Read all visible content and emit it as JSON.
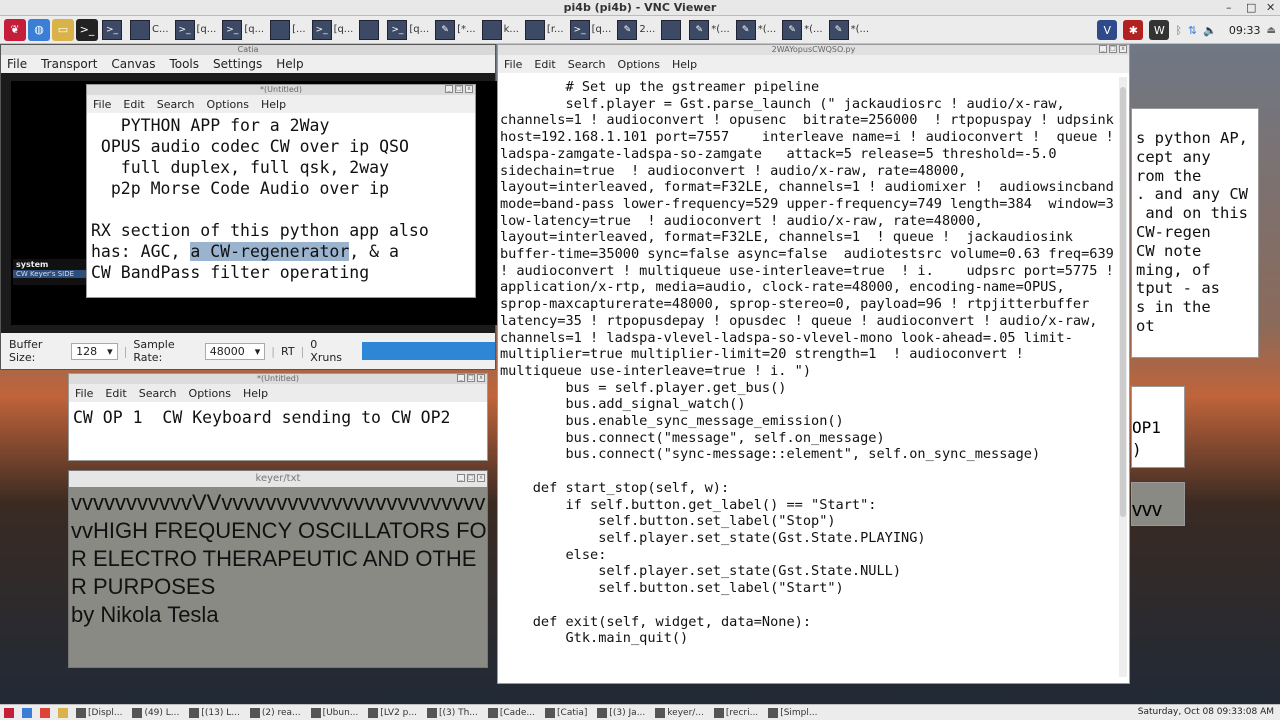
{
  "vnc": {
    "title": "pi4b (pi4b) - VNC Viewer",
    "controls": [
      "–",
      "□",
      "✕"
    ]
  },
  "top_panel": {
    "tasks": [
      {
        "label": "",
        "icon": "terminal-icon"
      },
      {
        "label": "C...",
        "icon": "cadence-icon"
      },
      {
        "label": "[q...",
        "icon": "terminal-icon"
      },
      {
        "label": "[q...",
        "icon": "terminal-icon"
      },
      {
        "label": "[...",
        "icon": "lv2-icon"
      },
      {
        "label": "[q...",
        "icon": "terminal-icon"
      },
      {
        "label": "",
        "icon": "raspberry-icon"
      },
      {
        "label": "[q...",
        "icon": "terminal-icon"
      },
      {
        "label": "[*...",
        "icon": "pencil-icon"
      },
      {
        "label": "k...",
        "icon": "keyer-icon"
      },
      {
        "label": "[r...",
        "icon": "file-icon"
      },
      {
        "label": "[q...",
        "icon": "terminal-icon"
      },
      {
        "label": "2...",
        "icon": "pencil-icon"
      },
      {
        "label": "",
        "icon": "window-icon"
      },
      {
        "label": "*(...",
        "icon": "pencil-icon"
      },
      {
        "label": "*(...",
        "icon": "pencil-icon"
      },
      {
        "label": "*(...",
        "icon": "pencil-icon"
      },
      {
        "label": "*(...",
        "icon": "pencil-icon"
      }
    ],
    "clock": "09:33"
  },
  "catia": {
    "title": "Catia",
    "menu": [
      "File",
      "Transport",
      "Canvas",
      "Tools",
      "Settings",
      "Help"
    ],
    "system_label": "system",
    "port_label": "CW Keyer's SIDE",
    "buffer_size_label": "Buffer Size:",
    "buffer_size_value": "128",
    "sample_rate_label": "Sample Rate:",
    "sample_rate_value": "48000",
    "rt_label": "RT",
    "xruns_label": "0 Xruns"
  },
  "editor1": {
    "title": "*(Untitled)",
    "menu": [
      "File",
      "Edit",
      "Search",
      "Options",
      "Help"
    ],
    "lines_a": "   PYTHON APP for a 2Way\n OPUS audio codec CW over ip QSO\n   full duplex, full qsk, 2way\n  p2p Morse Code Audio over ip\n\nRX section of this python app also\nhas: AGC, ",
    "highlight": "a CW-regenerator",
    "lines_b": ", & a\nCW BandPass filter operating"
  },
  "editor2": {
    "title": "*(Untitled)",
    "menu": [
      "File",
      "Edit",
      "Search",
      "Options",
      "Help"
    ],
    "text": "CW OP 1  CW Keyboard sending to CW OP2"
  },
  "keyer": {
    "title": "keyer/txt",
    "text": "vvvvvvvvvvvVVvvvvvvvvvvvvvvvvvvvvvvvvvvHIGH FREQUENCY OSCILLATORS FOR ELECTRO THERAPEUTIC AND OTHER PURPOSES\nby Nikola Tesla"
  },
  "code_editor": {
    "title": "2WAYopusCWQSO.py",
    "menu": [
      "File",
      "Edit",
      "Search",
      "Options",
      "Help"
    ],
    "code": "        # Set up the gstreamer pipeline\n        self.player = Gst.parse_launch (\" jackaudiosrc ! audio/x-raw, channels=1 ! audioconvert ! opusenc  bitrate=256000  ! rtpopuspay ! udpsink host=192.168.1.101 port=7557    interleave name=i ! audioconvert !  queue !  ladspa-zamgate-ladspa-so-zamgate   attack=5 release=5 threshold=-5.0  sidechain=true  ! audioconvert ! audio/x-raw, rate=48000, layout=interleaved, format=F32LE, channels=1 ! audiomixer !  audiowsincband mode=band-pass lower-frequency=529 upper-frequency=749 length=384  window=3 low-latency=true  ! audioconvert ! audio/x-raw, rate=48000, layout=interleaved, format=F32LE, channels=1  ! queue !  jackaudiosink buffer-time=35000 sync=false async=false  audiotestsrc volume=0.63 freq=639 ! audioconvert ! multiqueue use-interleave=true  ! i.    udpsrc port=5775 ! application/x-rtp, media=audio, clock-rate=48000, encoding-name=OPUS, sprop-maxcapturerate=48000, sprop-stereo=0, payload=96 ! rtpjitterbuffer latency=35 ! rtpopusdepay ! opusdec ! queue ! audioconvert ! audio/x-raw, channels=1 ! ladspa-vlevel-ladspa-so-vlevel-mono look-ahead=.05 limit-multiplier=true multiplier-limit=20 strength=1  ! audioconvert !     multiqueue use-interleave=true ! i. \")\n        bus = self.player.get_bus()\n        bus.add_signal_watch()\n        bus.enable_sync_message_emission()\n        bus.connect(\"message\", self.on_message)\n        bus.connect(\"sync-message::element\", self.on_sync_message)\n\n    def start_stop(self, w):\n        if self.button.get_label() == \"Start\":\n            self.button.set_label(\"Stop\")\n            self.player.set_state(Gst.State.PLAYING)\n        else:\n            self.player.set_state(Gst.State.NULL)\n            self.button.set_label(\"Start\")\n\n    def exit(self, widget, data=None):\n        Gtk.main_quit()"
  },
  "right_windows": {
    "w1_text": "s python AP,\ncept any\nrom the\n. and any CW\n and on this\nCW-regen\nCW note\nming, of\ntput - as\ns in the\not",
    "w2_text": "OP1\n)",
    "w3_text": "vvv"
  },
  "taskbar": {
    "tasks": [
      "[Displ...",
      "(49) L...",
      "[(13) L...",
      "(2) rea...",
      "[Ubun...",
      "[LV2 p...",
      "[(3) Th...",
      "[Cade...",
      "[Catia]",
      "[(3) Ja...",
      "keyer/...",
      "[recri...",
      "[Simpl..."
    ],
    "datetime": "Saturday, Oct 08 09:33:08 AM"
  },
  "colors": {
    "selection": "#9ab3cf",
    "xrun_bar": "#2e86d6",
    "keyer_bg": "#8a8a85"
  }
}
